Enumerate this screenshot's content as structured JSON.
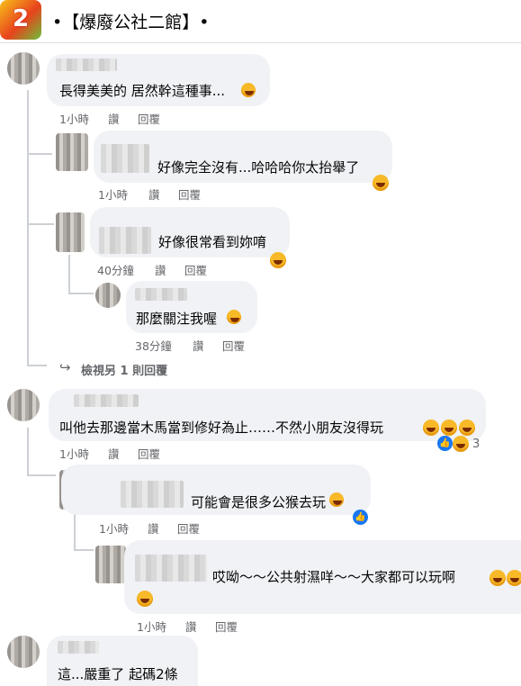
{
  "header": {
    "title": "•【爆廢公社二館】•",
    "logo_text": "2"
  },
  "comments": [
    {
      "text": "長得美美的 居然幹這種事...",
      "time": "1小時",
      "like": "讚",
      "reply": "回覆"
    },
    {
      "text": "好像完全沒有...哈哈哈你太抬舉了",
      "time": "1小時",
      "like": "讚",
      "reply": "回覆"
    },
    {
      "text": "好像很常看到妳唷",
      "time": "40分鐘",
      "like": "讚",
      "reply": "回覆"
    },
    {
      "text": "那麼關注我喔",
      "time": "38分鐘",
      "like": "讚",
      "reply": "回覆"
    },
    {
      "text": "叫他去那邊當木馬當到修好為止……不然小朋友沒得玩",
      "time": "1小時",
      "like": "讚",
      "reply": "回覆",
      "reaction_count": "3"
    },
    {
      "text": "可能會是很多公猴去玩",
      "time": "1小時",
      "like": "讚",
      "reply": "回覆"
    },
    {
      "text": "哎呦～～公共射濕咩～～大家都可以玩啊",
      "time": "1小時",
      "like": "讚",
      "reply": "回覆"
    },
    {
      "text": "這...嚴重了 起碼2條"
    }
  ],
  "more_replies": "檢視另 1 則回覆",
  "colors": {
    "bubble": "#f0f2f5",
    "meta": "#65676b",
    "like_blue": "#1877f2",
    "emoji": "#f7b928"
  }
}
